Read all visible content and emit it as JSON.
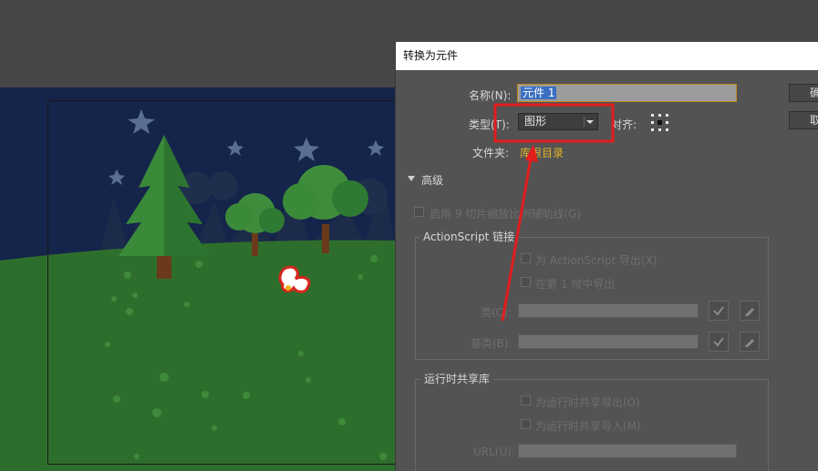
{
  "dialog": {
    "title": "转换为元件",
    "name_label": "名称(N):",
    "name_value": "元件 1",
    "type_label": "类型(T):",
    "type_value": "图形",
    "align_label": "对齐:",
    "folder_label": "文件夹:",
    "folder_value": "库根目录",
    "ok_label": "确定",
    "cancel_label": "取消",
    "advanced_label": "高级",
    "scale9_label": "启用 9 切片缩放比例辅助线(G)",
    "actionscript": {
      "title": "ActionScript 链接",
      "export_as_label": "为 ActionScript 导出(X)",
      "export_frame1_label": "在第 1 帧中导出",
      "class_label": "类(C):",
      "base_class_label": "基类(B):"
    },
    "runtime": {
      "title": "运行时共享库",
      "export_label": "为运行时共享导出(O)",
      "import_label": "为运行时共享导入(M)",
      "url_label": "URL(U):"
    }
  },
  "colors": {
    "sky": "#15244a",
    "grass": "#2e6e2c",
    "highlight": "#e11d1d",
    "folder_link": "#e3b22a",
    "selection": "#3b6fc1"
  }
}
